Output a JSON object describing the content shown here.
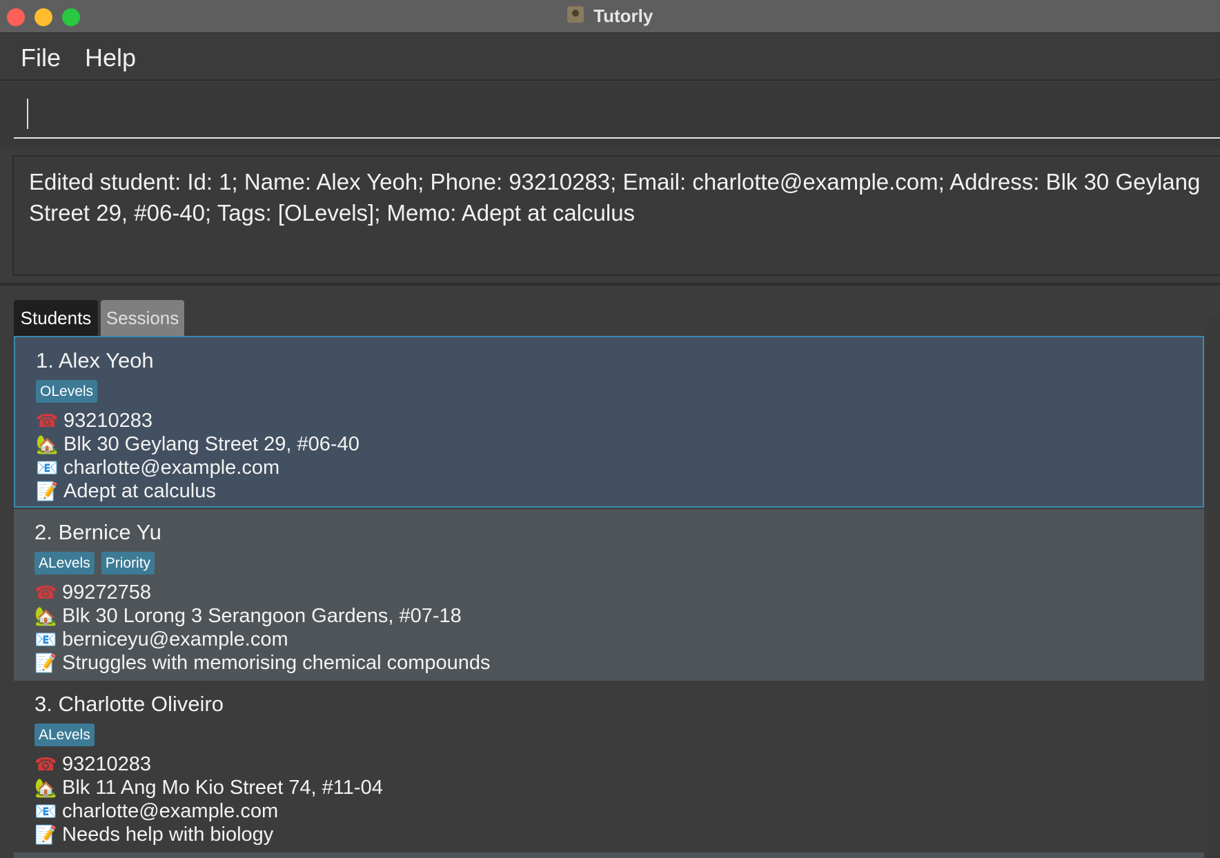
{
  "window": {
    "title": "Tutorly"
  },
  "menu": {
    "file": "File",
    "help": "Help"
  },
  "command": {
    "value": ""
  },
  "result": {
    "text": "Edited student: Id: 1; Name: Alex Yeoh; Phone: 93210283; Email: charlotte@example.com; Address: Blk 30 Geylang Street 29, #06-40; Tags: [OLevels]; Memo: Adept at calculus"
  },
  "tabs": {
    "students": "Students",
    "sessions": "Sessions",
    "selected": "Students"
  },
  "icons": {
    "phone": "☎",
    "address": "🏡",
    "email": "📧",
    "memo": "📝"
  },
  "students": [
    {
      "name": "1. Alex Yeoh",
      "tags": [
        "OLevels"
      ],
      "phone": "93210283",
      "address": "Blk 30 Geylang Street 29, #06-40",
      "email": "charlotte@example.com",
      "memo": "Adept at calculus",
      "selected": true
    },
    {
      "name": "2. Bernice Yu",
      "tags": [
        "ALevels",
        "Priority"
      ],
      "phone": "99272758",
      "address": "Blk 30 Lorong 3 Serangoon Gardens, #07-18",
      "email": "berniceyu@example.com",
      "memo": "Struggles with memorising chemical compounds",
      "selected": false
    },
    {
      "name": "3. Charlotte Oliveiro",
      "tags": [
        "ALevels"
      ],
      "phone": "93210283",
      "address": "Blk 11 Ang Mo Kio Street 74, #11-04",
      "email": "charlotte@example.com",
      "memo": "Needs help with biology",
      "selected": false
    }
  ],
  "colors": {
    "selected_card_bg": "#435061",
    "selected_card_border": "#3a8bb2",
    "alt_card_bg": "#4f5458",
    "tag_bg": "#3d7a96"
  }
}
